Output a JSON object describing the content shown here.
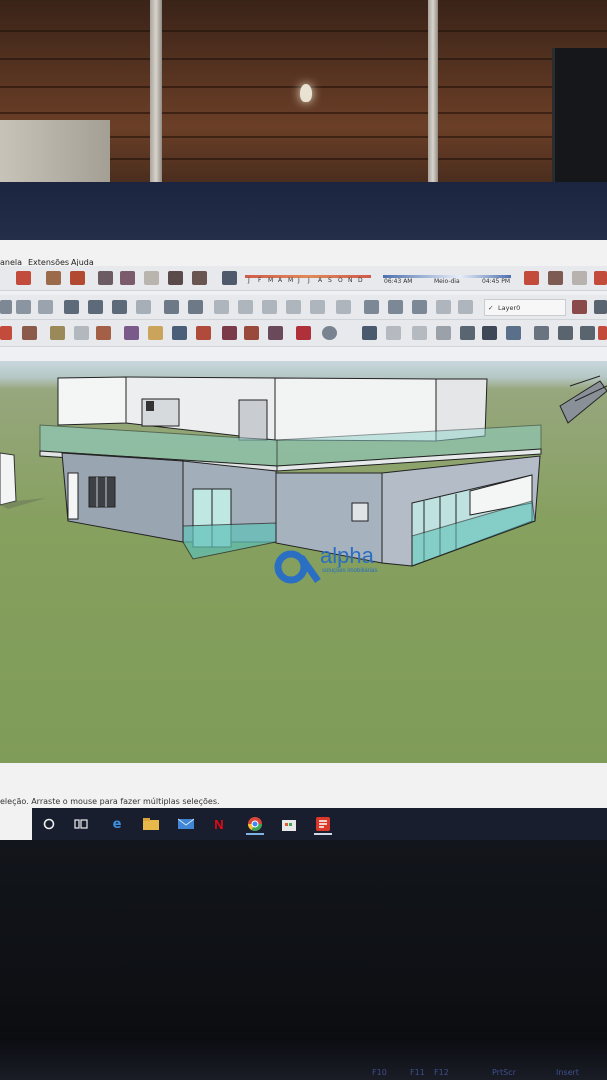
{
  "menu": {
    "items": [
      "anela",
      "Extensões",
      "Ajuda"
    ]
  },
  "shadow_bar": {
    "months": [
      "J",
      "F",
      "M",
      "A",
      "M",
      "J",
      "J",
      "A",
      "S",
      "O",
      "N",
      "D"
    ],
    "time_start": "06:43 AM",
    "time_mid": "Meio-dia",
    "time_end": "04:45 PM"
  },
  "layer": {
    "label": "Layer0",
    "check": "✓"
  },
  "watermark": {
    "name": "alpha",
    "tagline": "soluções imobiliárias"
  },
  "status": {
    "text": "eleção. Arraste o mouse para fazer múltiplas seleções."
  },
  "taskbar": {
    "items": [
      "cortana-circle",
      "task-view",
      "edge",
      "file-explorer",
      "mail",
      "netflix",
      "chrome",
      "store",
      "sketchup"
    ]
  },
  "keyboard": {
    "keys": [
      "F10",
      "F11",
      "F12",
      "PrtScr",
      "Insert"
    ]
  },
  "colors": {
    "sky": "#c9d8dd",
    "grass": "#83a05c",
    "wall_gray": "#a3aebd",
    "wall_white": "#f2f3f3",
    "glass": "#7fd0c8",
    "taskbar": "#181e2e"
  }
}
